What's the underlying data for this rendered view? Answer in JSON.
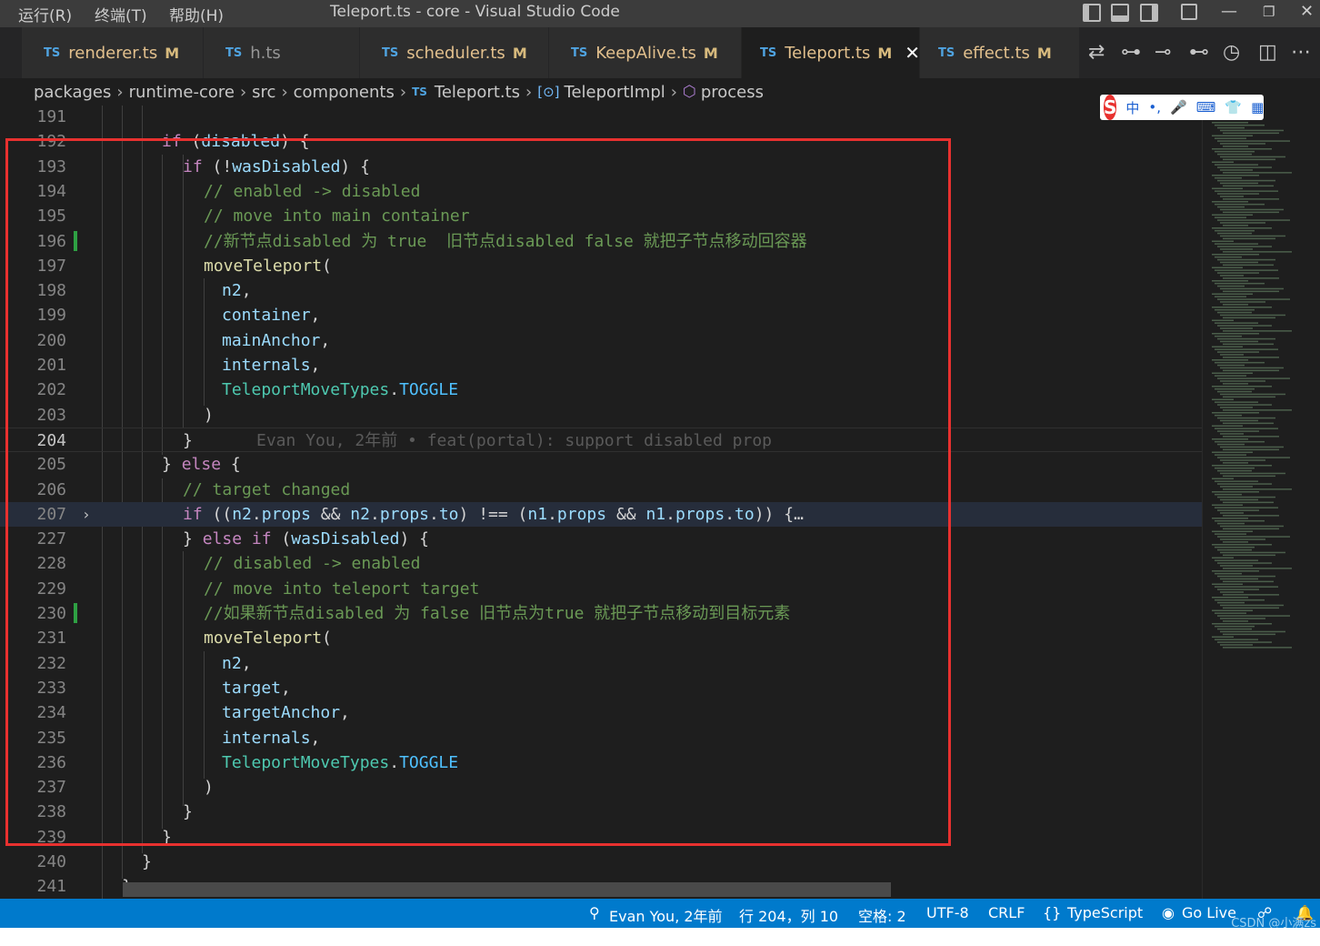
{
  "titlebar": {
    "menu": [
      "运行(R)",
      "终端(T)",
      "帮助(H)"
    ],
    "title": "Teleport.ts - core - Visual Studio Code"
  },
  "tabs": [
    {
      "lang": "TS",
      "name": "renderer.ts",
      "mod": "M",
      "active": false
    },
    {
      "lang": "TS",
      "name": "h.ts",
      "mod": "",
      "active": false
    },
    {
      "lang": "TS",
      "name": "scheduler.ts",
      "mod": "M",
      "active": false
    },
    {
      "lang": "TS",
      "name": "KeepAlive.ts",
      "mod": "M",
      "active": false
    },
    {
      "lang": "TS",
      "name": "Teleport.ts",
      "mod": "M",
      "active": true
    },
    {
      "lang": "TS",
      "name": "effect.ts",
      "mod": "M",
      "active": false
    }
  ],
  "breadcrumb": {
    "parts": [
      "packages",
      "runtime-core",
      "src",
      "components"
    ],
    "file_lang": "TS",
    "file": "Teleport.ts",
    "symbol": "TeleportImpl",
    "method": "process"
  },
  "ime": {
    "label": "中"
  },
  "editor": {
    "blame": "Evan You, 2年前 • feat(portal): support disabled prop",
    "lines": [
      {
        "n": "191",
        "code": ""
      },
      {
        "n": "192",
        "code": "if (disabled) {"
      },
      {
        "n": "193",
        "code": "if (!wasDisabled) {"
      },
      {
        "n": "194",
        "code": "// enabled -> disabled"
      },
      {
        "n": "195",
        "code": "// move into main container"
      },
      {
        "n": "196",
        "code": "//新节点disabled 为 true  旧节点disabled false 就把子节点移动回容器"
      },
      {
        "n": "197",
        "code": "moveTeleport("
      },
      {
        "n": "198",
        "code": "n2,"
      },
      {
        "n": "199",
        "code": "container,"
      },
      {
        "n": "200",
        "code": "mainAnchor,"
      },
      {
        "n": "201",
        "code": "internals,"
      },
      {
        "n": "202",
        "code": "TeleportMoveTypes.TOGGLE"
      },
      {
        "n": "203",
        "code": ")"
      },
      {
        "n": "204",
        "code": "}"
      },
      {
        "n": "205",
        "code": "} else {"
      },
      {
        "n": "206",
        "code": "// target changed"
      },
      {
        "n": "207",
        "code": "if ((n2.props && n2.props.to) !== (n1.props && n1.props.to)) {…"
      },
      {
        "n": "227",
        "code": "} else if (wasDisabled) {"
      },
      {
        "n": "228",
        "code": "// disabled -> enabled"
      },
      {
        "n": "229",
        "code": "// move into teleport target"
      },
      {
        "n": "230",
        "code": "//如果新节点disabled 为 false 旧节点为true 就把子节点移动到目标元素"
      },
      {
        "n": "231",
        "code": "moveTeleport("
      },
      {
        "n": "232",
        "code": "n2,"
      },
      {
        "n": "233",
        "code": "target,"
      },
      {
        "n": "234",
        "code": "targetAnchor,"
      },
      {
        "n": "235",
        "code": "internals,"
      },
      {
        "n": "236",
        "code": "TeleportMoveTypes.TOGGLE"
      },
      {
        "n": "237",
        "code": ")"
      },
      {
        "n": "238",
        "code": "}"
      },
      {
        "n": "239",
        "code": "}"
      },
      {
        "n": "240",
        "code": "}"
      },
      {
        "n": "241",
        "code": "},"
      }
    ]
  },
  "statusbar": {
    "blame": "Evan You, 2年前",
    "position": "行 204，列 10",
    "spaces": "空格: 2",
    "encoding": "UTF-8",
    "eol": "CRLF",
    "language": "TypeScript",
    "golive": "Go Live",
    "watermark": "CSDN @小满zs"
  },
  "colors": {
    "statusbar": "#007acc",
    "annotation_box": "#e8312f",
    "editor_bg": "#1e1e1e"
  }
}
